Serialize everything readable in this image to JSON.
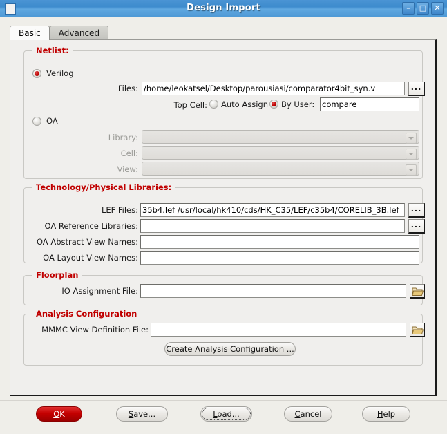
{
  "window": {
    "title": "Design Import",
    "controls": {
      "menu_icon": "window-menu-icon",
      "minimize": "–",
      "maximize": "□",
      "close": "✕"
    }
  },
  "tabs": [
    {
      "label": "Basic",
      "active": true
    },
    {
      "label": "Advanced",
      "active": false
    }
  ],
  "netlist": {
    "legend": "Netlist:",
    "verilog": {
      "label": "Verilog",
      "selected": true
    },
    "files": {
      "label": "Files:",
      "value": "/home/leokatsel/Desktop/parousiasi/comparator4bit_syn.v",
      "browse": "..."
    },
    "top_cell": {
      "label": "Top Cell:",
      "auto_assign": {
        "label": "Auto Assign",
        "selected": false
      },
      "by_user": {
        "label": "By User:",
        "selected": true,
        "value": "compare"
      }
    },
    "oa": {
      "label": "OA",
      "selected": false
    },
    "library": {
      "label": "Library:",
      "value": "",
      "disabled": true
    },
    "cell": {
      "label": "Cell:",
      "value": "",
      "disabled": true
    },
    "view": {
      "label": "View:",
      "value": "",
      "disabled": true
    }
  },
  "technology": {
    "legend": "Technology/Physical Libraries:",
    "lef_files": {
      "label": "LEF Files:",
      "value": "35b4.lef  /usr/local/hk410/cds/HK_C35/LEF/c35b4/CORELIB_3B.lef",
      "browse": "..."
    },
    "oa_reference_libraries": {
      "label": "OA Reference Libraries:",
      "value": "",
      "browse": "..."
    },
    "oa_abstract_view_names": {
      "label": "OA Abstract View Names:",
      "value": ""
    },
    "oa_layout_view_names": {
      "label": "OA Layout View Names:",
      "value": ""
    }
  },
  "floorplan": {
    "legend": "Floorplan",
    "io_assignment_file": {
      "label": "IO Assignment File:",
      "value": "",
      "browse_icon": "folder-open-icon"
    }
  },
  "analysis": {
    "legend": "Analysis Configuration",
    "mmmc_view_definition_file": {
      "label": "MMMC View Definition File:",
      "value": "",
      "browse_icon": "folder-open-icon"
    },
    "create_button": "Create Analysis Configuration ..."
  },
  "buttons": {
    "ok": {
      "pre": "",
      "mnemonic": "O",
      "post": "K"
    },
    "save": {
      "pre": "",
      "mnemonic": "S",
      "post": "ave..."
    },
    "load": {
      "pre": "",
      "mnemonic": "L",
      "post": "oad..."
    },
    "cancel": {
      "pre": "",
      "mnemonic": "C",
      "post": "ancel"
    },
    "help": {
      "pre": "",
      "mnemonic": "H",
      "post": "elp"
    }
  },
  "colors": {
    "legend_red": "#c00000",
    "ok_red": "#c40000",
    "titlebar_blue": "#4b94d4"
  }
}
